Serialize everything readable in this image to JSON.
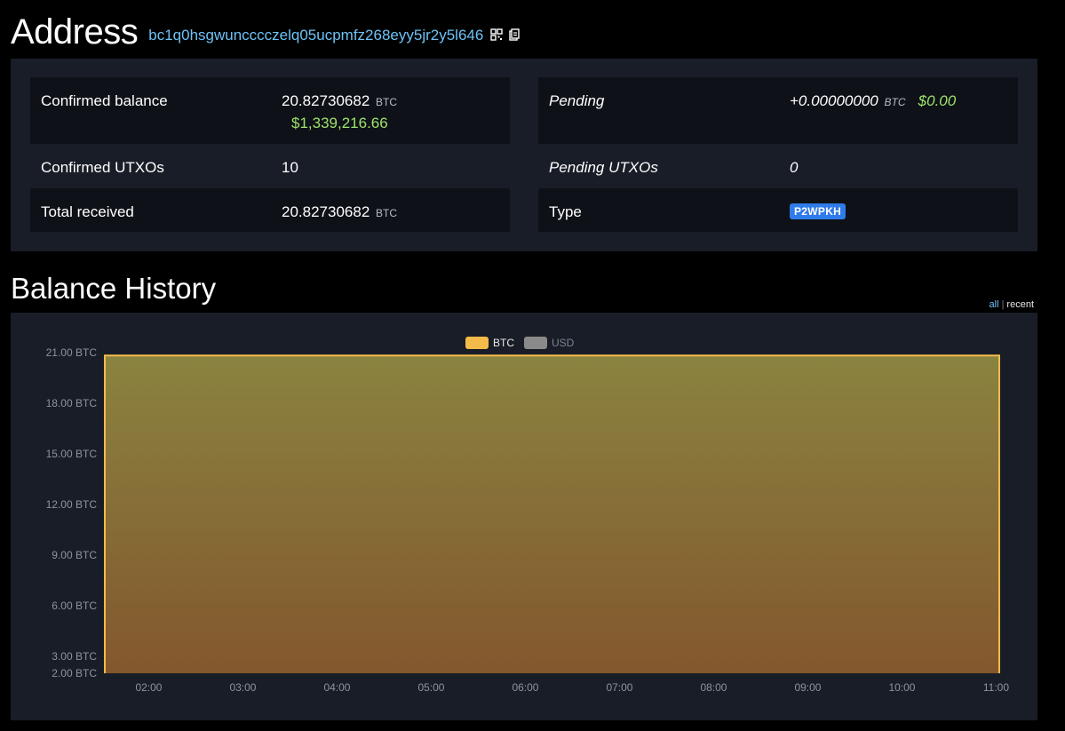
{
  "header": {
    "title": "Address",
    "address": "bc1q0hsgwuncccczelq05ucpmfz268eyy5jr2y5l646",
    "icons": [
      "qr-code-icon",
      "copy-icon"
    ]
  },
  "summary": {
    "confirmed_balance": {
      "label": "Confirmed balance",
      "value": "20.82730682",
      "unit": "BTC",
      "usd": "$1,339,216.66"
    },
    "pending": {
      "label": "Pending",
      "value": "+0.00000000",
      "unit": "BTC",
      "usd": "$0.00"
    },
    "confirmed_utxos": {
      "label": "Confirmed UTXOs",
      "value": "10"
    },
    "pending_utxos": {
      "label": "Pending UTXOs",
      "value": "0"
    },
    "total_received": {
      "label": "Total received",
      "value": "20.82730682",
      "unit": "BTC"
    },
    "type": {
      "label": "Type",
      "value": "P2WPKH"
    }
  },
  "balance_history": {
    "title": "Balance History",
    "range_all": "all",
    "range_separator": "|",
    "range_recent": "recent"
  },
  "colors": {
    "accent_link": "#6ec1f5",
    "usd_green": "#9ee36b",
    "badge_blue": "#2f7be9",
    "btc_series": "#f5bb4a",
    "usd_series": "#8a8a8a"
  },
  "chart_data": {
    "type": "area",
    "legend": [
      "BTC",
      "USD"
    ],
    "legend_position": "top-center",
    "x": [
      "01:32",
      "02:00",
      "03:00",
      "04:00",
      "05:00",
      "06:00",
      "07:00",
      "08:00",
      "09:00",
      "10:00",
      "11:00",
      "11:02"
    ],
    "x_ticks": [
      "02:00",
      "03:00",
      "04:00",
      "05:00",
      "06:00",
      "07:00",
      "08:00",
      "09:00",
      "10:00",
      "11:00"
    ],
    "series": [
      {
        "name": "BTC",
        "values": [
          20.83,
          20.83,
          20.83,
          20.83,
          20.83,
          20.83,
          20.83,
          20.83,
          20.83,
          20.83,
          20.83,
          20.83
        ]
      }
    ],
    "y_ticks": [
      "2.00 BTC",
      "3.00 BTC",
      "6.00 BTC",
      "9.00 BTC",
      "12.00 BTC",
      "15.00 BTC",
      "18.00 BTC",
      "21.00 BTC"
    ],
    "y_tick_values": [
      2,
      3,
      6,
      9,
      12,
      15,
      18,
      21
    ],
    "ylim": [
      2,
      21
    ],
    "grid": false
  }
}
